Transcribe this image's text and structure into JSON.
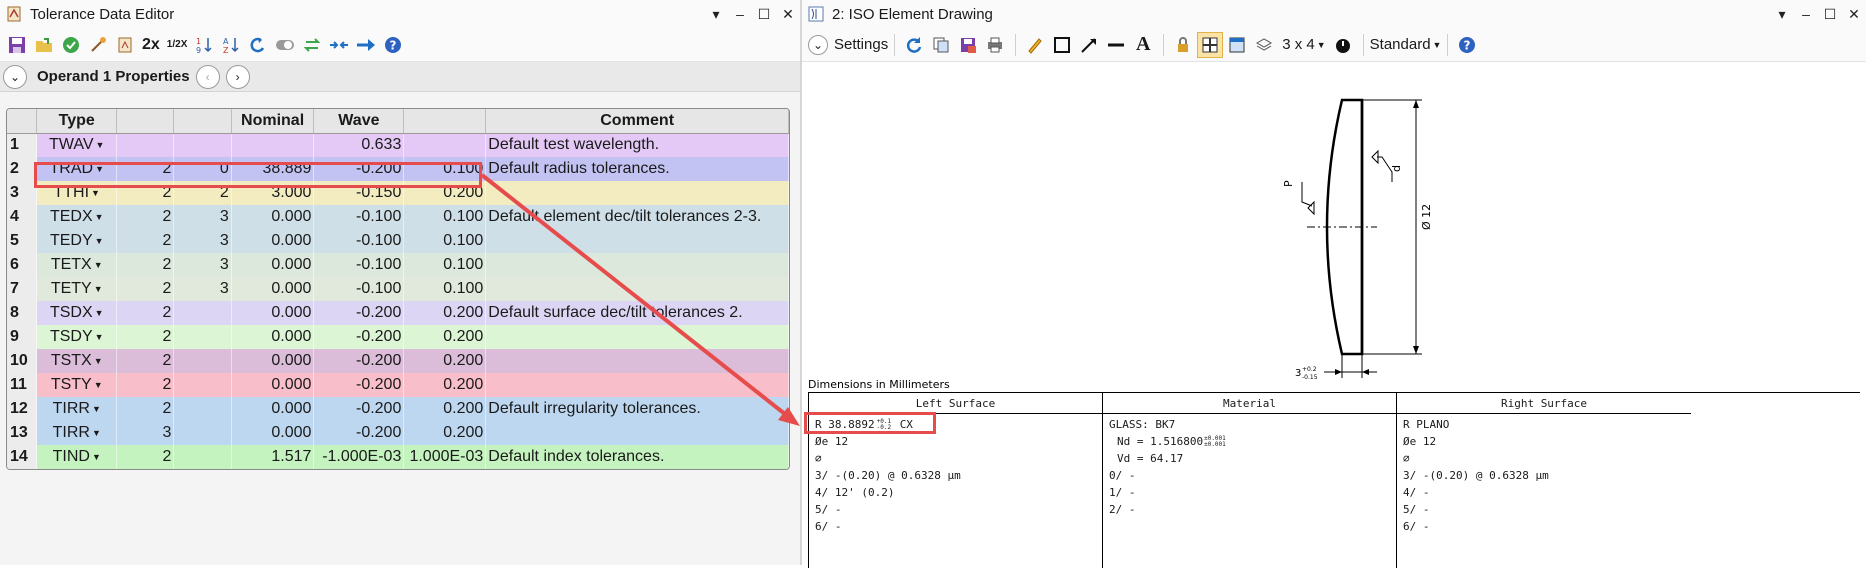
{
  "left_window": {
    "title": "Tolerance Data Editor",
    "controls": [
      "▾",
      "–",
      "☐",
      "✕"
    ],
    "toolbar": {
      "zoom_2x": "2x",
      "zoom_half": "1/2X"
    },
    "operand_bar": {
      "label": "Operand  1 Properties"
    },
    "grid": {
      "headers": [
        "",
        "Type",
        "",
        "",
        "Nominal",
        "Wave",
        "",
        "Comment"
      ],
      "rows": [
        {
          "n": "1",
          "type": "TWAV",
          "c1": "",
          "c2": "",
          "nominal": "",
          "c4": "0.633",
          "c5": "",
          "comment": "Default test wavelength.",
          "color": "#e4c9f6"
        },
        {
          "n": "2",
          "type": "TRAD",
          "c1": "2",
          "c2": "0",
          "nominal": "38.889",
          "c4": "-0.200",
          "c5": "0.100",
          "comment": "Default radius tolerances.",
          "color": "#c3c3f3"
        },
        {
          "n": "3",
          "type": "TTHI",
          "c1": "2",
          "c2": "2",
          "nominal": "3.000",
          "c4": "-0.150",
          "c5": "0.200",
          "comment": "",
          "color": "#f2ecc0"
        },
        {
          "n": "4",
          "type": "TEDX",
          "c1": "2",
          "c2": "3",
          "nominal": "0.000",
          "c4": "-0.100",
          "c5": "0.100",
          "comment": "Default element dec/tilt tolerances 2-3.",
          "color": "#cfdfe8"
        },
        {
          "n": "5",
          "type": "TEDY",
          "c1": "2",
          "c2": "3",
          "nominal": "0.000",
          "c4": "-0.100",
          "c5": "0.100",
          "comment": "",
          "color": "#cfdfe8"
        },
        {
          "n": "6",
          "type": "TETX",
          "c1": "2",
          "c2": "3",
          "nominal": "0.000",
          "c4": "-0.100",
          "c5": "0.100",
          "comment": "",
          "color": "#dde8dd"
        },
        {
          "n": "7",
          "type": "TETY",
          "c1": "2",
          "c2": "3",
          "nominal": "0.000",
          "c4": "-0.100",
          "c5": "0.100",
          "comment": "",
          "color": "#e1e8dc"
        },
        {
          "n": "8",
          "type": "TSDX",
          "c1": "2",
          "c2": "",
          "nominal": "0.000",
          "c4": "-0.200",
          "c5": "0.200",
          "comment": "Default surface dec/tilt tolerances 2.",
          "color": "#dcd6f4"
        },
        {
          "n": "9",
          "type": "TSDY",
          "c1": "2",
          "c2": "",
          "nominal": "0.000",
          "c4": "-0.200",
          "c5": "0.200",
          "comment": "",
          "color": "#dcf5d4"
        },
        {
          "n": "10",
          "type": "TSTX",
          "c1": "2",
          "c2": "",
          "nominal": "0.000",
          "c4": "-0.200",
          "c5": "0.200",
          "comment": "",
          "color": "#dbbcd9"
        },
        {
          "n": "11",
          "type": "TSTY",
          "c1": "2",
          "c2": "",
          "nominal": "0.000",
          "c4": "-0.200",
          "c5": "0.200",
          "comment": "",
          "color": "#f8bfcb"
        },
        {
          "n": "12",
          "type": "TIRR",
          "c1": "2",
          "c2": "",
          "nominal": "0.000",
          "c4": "-0.200",
          "c5": "0.200",
          "comment": "Default irregularity tolerances.",
          "color": "#bdd7f0"
        },
        {
          "n": "13",
          "type": "TIRR",
          "c1": "3",
          "c2": "",
          "nominal": "0.000",
          "c4": "-0.200",
          "c5": "0.200",
          "comment": "",
          "color": "#bdd7f0"
        },
        {
          "n": "14",
          "type": "TIND",
          "c1": "2",
          "c2": "",
          "nominal": "1.517",
          "c4": "-1.000E-03",
          "c5": "1.000E-03",
          "comment": "Default index tolerances.",
          "color": "#c5f3bf"
        }
      ]
    }
  },
  "right_window": {
    "title": "2: ISO Element Drawing",
    "controls": [
      "▾",
      "–",
      "☐",
      "✕"
    ],
    "toolbar": {
      "settings": "Settings",
      "layout": "3 x 4",
      "style": "Standard"
    },
    "drawing": {
      "dim_label": "Dimensions in Millimeters",
      "diameter_label": "Ø 12",
      "p_label": "P",
      "d_label": "d",
      "thickness_label": "3",
      "thickness_tol_up": "+0.2",
      "thickness_tol_dn": "-0.15",
      "left_header": "Left Surface",
      "material_header": "Material",
      "right_header": "Right Surface",
      "left_radius": "R 38.8892",
      "left_radius_tol_up": "+0.1",
      "left_radius_tol_dn": "-0.2",
      "left_radius_suffix": "CX",
      "left_lines": [
        "Øe 12",
        "⌀",
        "3/ -(0.20) @ 0.6328 µm",
        "4/ 12' (0.2)",
        "5/ -",
        "6/ -"
      ],
      "material_glass": "GLASS: BK7",
      "material_nd": "Nd = 1.516800",
      "material_nd_tol_up": "±0.001",
      "material_nd_tol_dn": "±0.001",
      "material_vd": "Vd = 64.17",
      "material_lines": [
        "0/ -",
        "1/ -",
        "2/ -"
      ],
      "right_lines": [
        "R PLANO",
        "Øe 12",
        "⌀",
        "3/ -(0.20) @ 0.6328 µm",
        "4/ -",
        "5/ -",
        "6/ -"
      ]
    }
  },
  "colors": {
    "highlight": "#e74c4c",
    "arrow": "#e74c4c"
  }
}
